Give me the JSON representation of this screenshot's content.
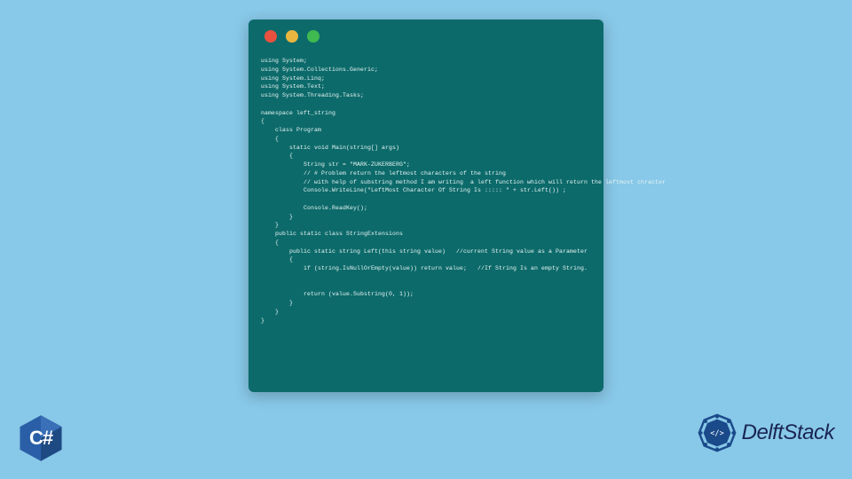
{
  "code_window": {
    "lines": [
      "using System;",
      "using System.Collections.Generic;",
      "using System.Linq;",
      "using System.Text;",
      "using System.Threading.Tasks;",
      "",
      "namespace left_string",
      "{",
      "    class Program",
      "    {",
      "        static void Main(string[] args)",
      "        {",
      "            String str = \"MARK-ZUKERBERG\";",
      "            // # Problem return the leftmost characters of the string",
      "            // with help of substring method I am writing  a left function which will return the leftmost chracter",
      "            Console.WriteLine(\"LeftMost Character Of String Is ::::: \" + str.Left()) ;",
      "",
      "            Console.ReadKey();",
      "        }",
      "    }",
      "    public static class StringExtensions",
      "    {",
      "        public static string Left(this string value)   //current String value as a Parameter",
      "        {",
      "            if (string.IsNullOrEmpty(value)) return value;   //If String Is an empty String.",
      "",
      "",
      "            return (value.Substring(0, 1));",
      "        }",
      "    }",
      "}"
    ]
  },
  "csharp_label": "C#",
  "delft_label": "DelftStack"
}
